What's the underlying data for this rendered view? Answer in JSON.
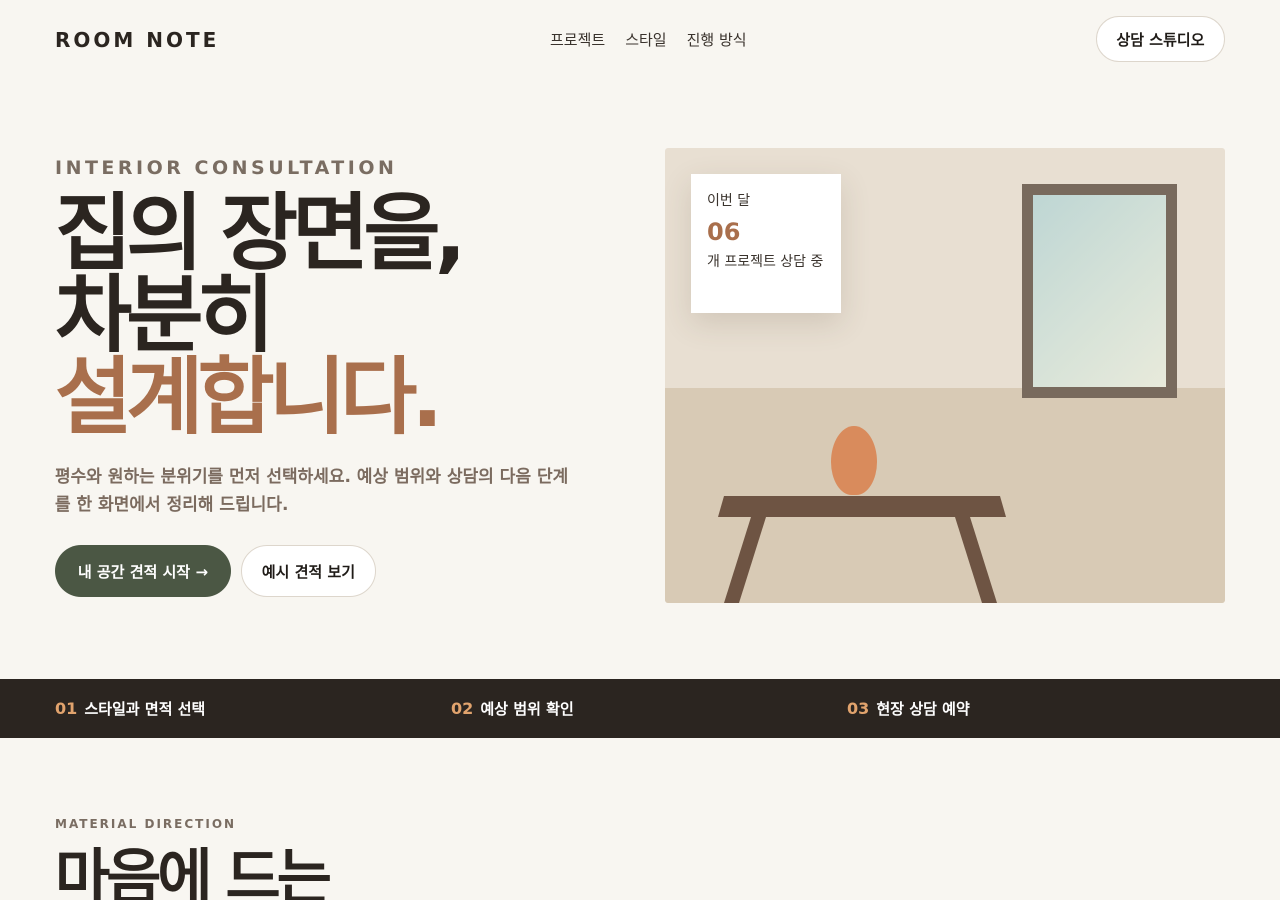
{
  "header": {
    "logo": "ROOM NOTE",
    "nav": [
      "프로젝트",
      "스타일",
      "진행 방식"
    ],
    "cta": "상담 스튜디오"
  },
  "hero": {
    "eyebrow": "INTERIOR CONSULTATION",
    "title_line1": "집의 장면을,",
    "title_line2": "차분히",
    "title_accent": "설계합니다.",
    "description": "평수와 원하는 분위기를 먼저 선택하세요. 예상 범위와 상담의 다음 단계를 한 화면에서 정리해 드립니다.",
    "primary_button": "내 공간 견적 시작 →",
    "secondary_button": "예시 견적 보기"
  },
  "stat_card": {
    "label": "이번 달",
    "value": "06",
    "description": "개 프로젝트 상담 중"
  },
  "steps": [
    {
      "num": "01",
      "label": "스타일과 면적 선택"
    },
    {
      "num": "02",
      "label": "예상 범위 확인"
    },
    {
      "num": "03",
      "label": "현장 상담 예약"
    }
  ],
  "material_section": {
    "eyebrow": "MATERIAL DIRECTION",
    "title": "마음에 드는"
  },
  "colors": {
    "background": "#f8f6f1",
    "accent": "#a96f4c",
    "primary_button": "#4b5744",
    "dark": "#2b2520",
    "step_number": "#e1a36d"
  }
}
